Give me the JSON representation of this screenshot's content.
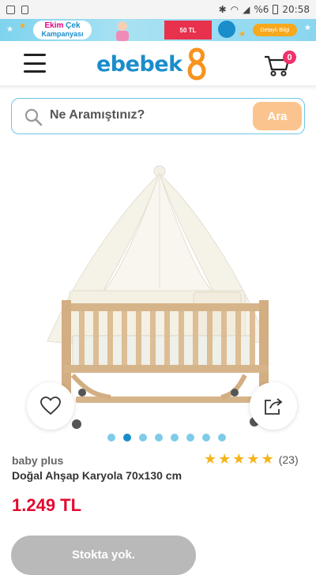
{
  "status_bar": {
    "signal": "%6",
    "time": "20:58"
  },
  "promo": {
    "line1_a": "Ekim",
    "line1_b": "Çek",
    "line2": "Kampanyası",
    "badge": "50 TL",
    "detail": "Detaylı Bilgi"
  },
  "header": {
    "logo": "ebebek",
    "cart_count": "0"
  },
  "search": {
    "placeholder": "Ne Aramıştınız?",
    "button": "Ara"
  },
  "carousel": {
    "count": 8,
    "active_index": 1
  },
  "product": {
    "brand": "baby plus",
    "title": "Doğal Ahşap Karyola 70x130 cm",
    "rating_stars": 5,
    "rating_count": "(23)",
    "price": "1.249 TL",
    "stock_button": "Stokta yok."
  },
  "colors": {
    "brand_blue": "#1a8dcb",
    "price_red": "#e30a2f",
    "search_button": "#fbc48e"
  }
}
